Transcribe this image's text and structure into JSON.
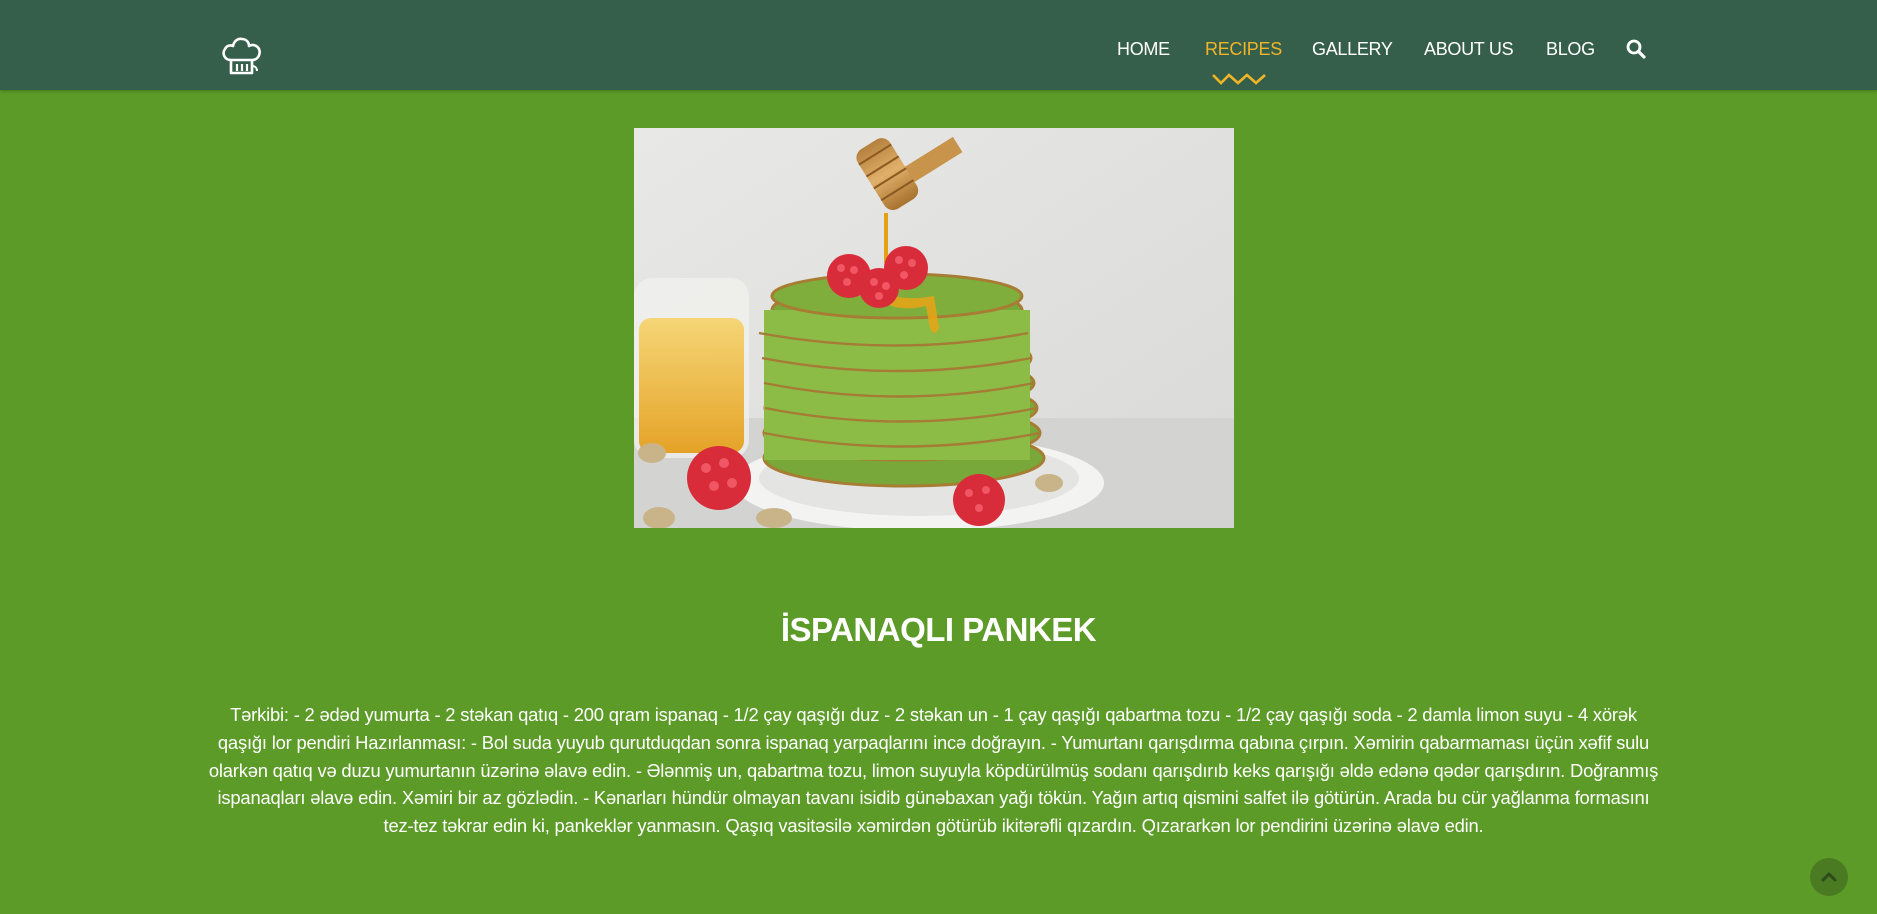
{
  "nav": {
    "logo_icon": "chef-hat-icon",
    "items": [
      {
        "label": "HOME",
        "active": false
      },
      {
        "label": "RECIPES",
        "active": true
      },
      {
        "label": "GALLERY",
        "active": false
      },
      {
        "label": "ABOUT US",
        "active": false
      },
      {
        "label": "BLOG",
        "active": false
      }
    ],
    "search_icon": "search-icon"
  },
  "recipe": {
    "image_subject": "stack of spinach pancakes with raspberries and honey",
    "title": "İSPANAQLI PANKEK",
    "body": "Tərkibi: - 2 ədəd yumurta - 2 stəkan qatıq - 200 qram ispanaq - 1/2 çay qaşığı duz - 2 stəkan un - 1 çay qaşığı qabartma tozu - 1/2 çay qaşığı soda - 2 damla limon suyu - 4 xörək qaşığı lor pendiri Hazırlanması: - Bol suda yuyub qurutduqdan sonra ispanaq yarpaqlarını incə doğrayın. - Yumurtanı qarışdırma qabına çırpın. Xəmirin qabarmaması üçün xəfif sulu olarkən qatıq və duzu yumurtanın üzərinə əlavə edin. - Ələnmiş un, qabartma tozu, limon suyuyla köpdürülmüş sodanı qarışdırıb keks qarışığı əldə edənə qədər qarışdırın. Doğranmış ispanaqları əlavə edin. Xəmiri bir az gözlədin. - Kənarları hündür olmayan tavanı isidib günəbaxan yağı tökün. Yağın artıq qismini salfet ilə götürün. Arada bu cür yağlanma formasını tez-tez təkrar edin ki, pankeklər yanmasın. Qaşıq vasitəsilə xəmirdən götürüb ikitərəfli qızardın. Qızararkən lor pendirini üzərinə əlavə edin."
  },
  "scroll_top_icon": "chevron-up-icon",
  "colors": {
    "page_background": "#5c9b27",
    "navbar_background": "#365f4b",
    "accent": "#f0b429",
    "text": "#ffffff"
  }
}
